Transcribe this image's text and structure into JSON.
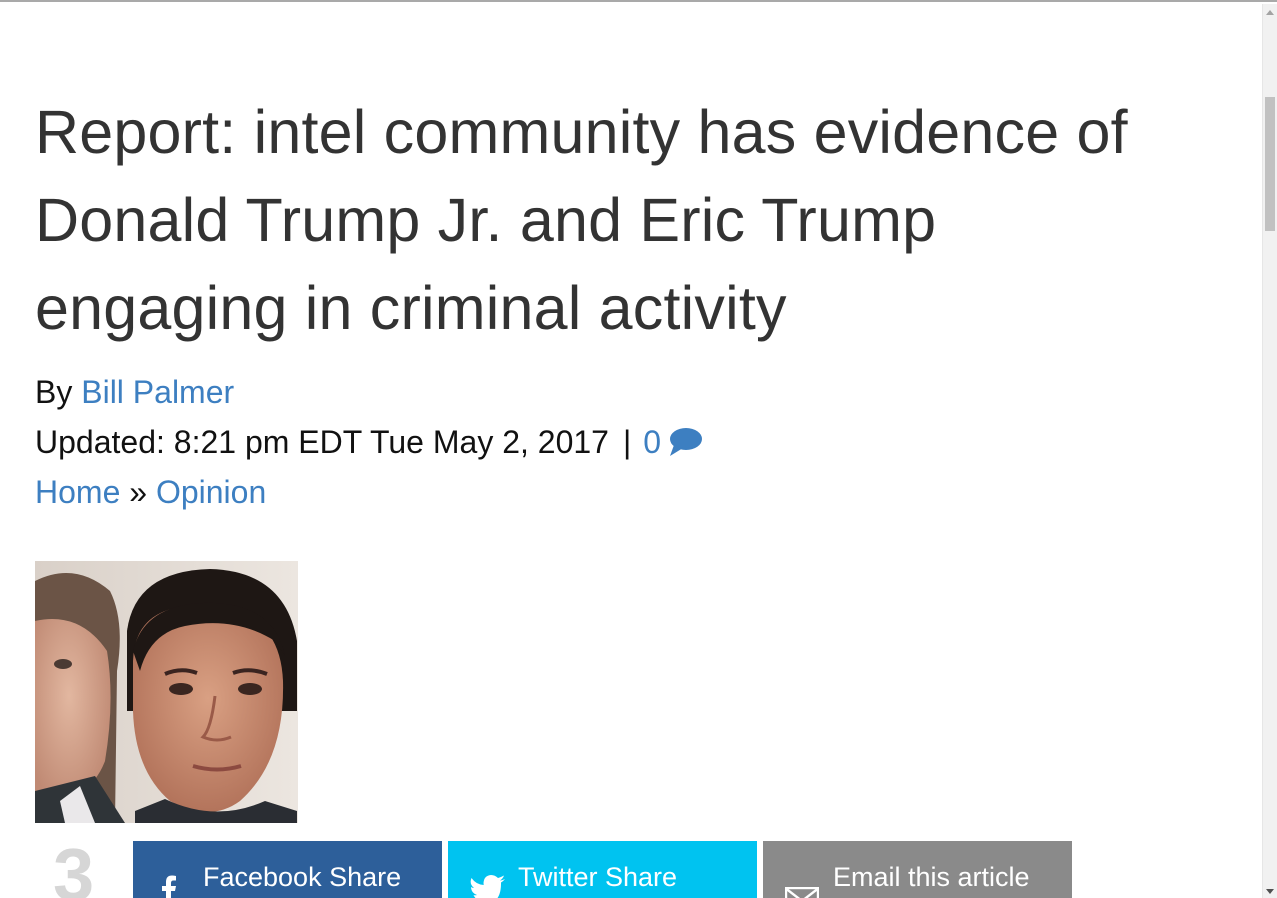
{
  "article": {
    "title": "Report: intel community has evidence of Donald Trump Jr. and Eric Trump engaging in criminal activity",
    "byline_prefix": "By",
    "author": "Bill Palmer",
    "updated_text": "Updated: 8:21 pm EDT Tue May 2, 2017",
    "separator": "|",
    "comment_count": "0",
    "comment_icon": "speech-bubble-icon"
  },
  "breadcrumb": {
    "home": "Home",
    "separator": "»",
    "section": "Opinion"
  },
  "share": {
    "count": "3",
    "facebook_label": "Facebook Share",
    "twitter_label": "Twitter Share",
    "email_label": "Email this article"
  },
  "colors": {
    "link": "#3d7fc1",
    "facebook": "#2d5f9a",
    "twitter": "#00c3f0",
    "email": "#8a8a8a"
  }
}
